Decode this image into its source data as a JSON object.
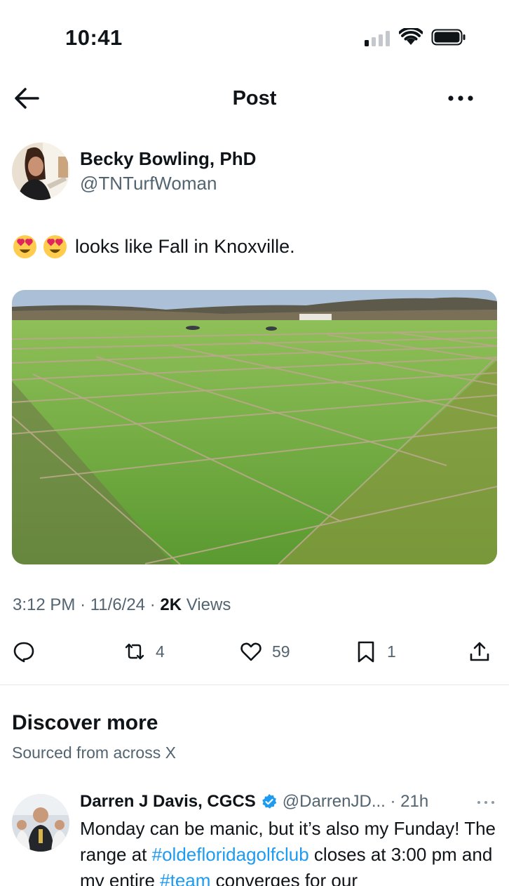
{
  "status_bar": {
    "time": "10:41"
  },
  "header": {
    "title": "Post"
  },
  "post": {
    "author_name": "Becky Bowling, PhD",
    "author_handle": "@TNTurfWoman",
    "text": "looks like Fall in Knoxville.",
    "emojis": [
      "heart-eyes-emoji",
      "heart-eyes-emoji"
    ],
    "image_icon": "turfgrass-plots-photo",
    "time": "3:12 PM",
    "date": "11/6/24",
    "views_count": "2K",
    "views_label": "Views",
    "actions": {
      "retweets": "4",
      "likes": "59",
      "bookmarks": "1"
    }
  },
  "discover": {
    "title": "Discover more",
    "subtitle": "Sourced from across X"
  },
  "tweet2": {
    "author_name": "Darren J Davis, CGCS",
    "author_handle": "@DarrenJD...",
    "time": "21h",
    "body_1": "Monday can be manic, but it’s also my Funday! The range at ",
    "tag_1": "#oldefloridagolfclub",
    "body_2": " closes at 3:00 pm and my entire ",
    "tag_2": "#team",
    "body_3": " converges for our"
  },
  "colors": {
    "link": "#1d9bf0",
    "secondary_text": "#536471",
    "primary_text": "#0f1419"
  }
}
